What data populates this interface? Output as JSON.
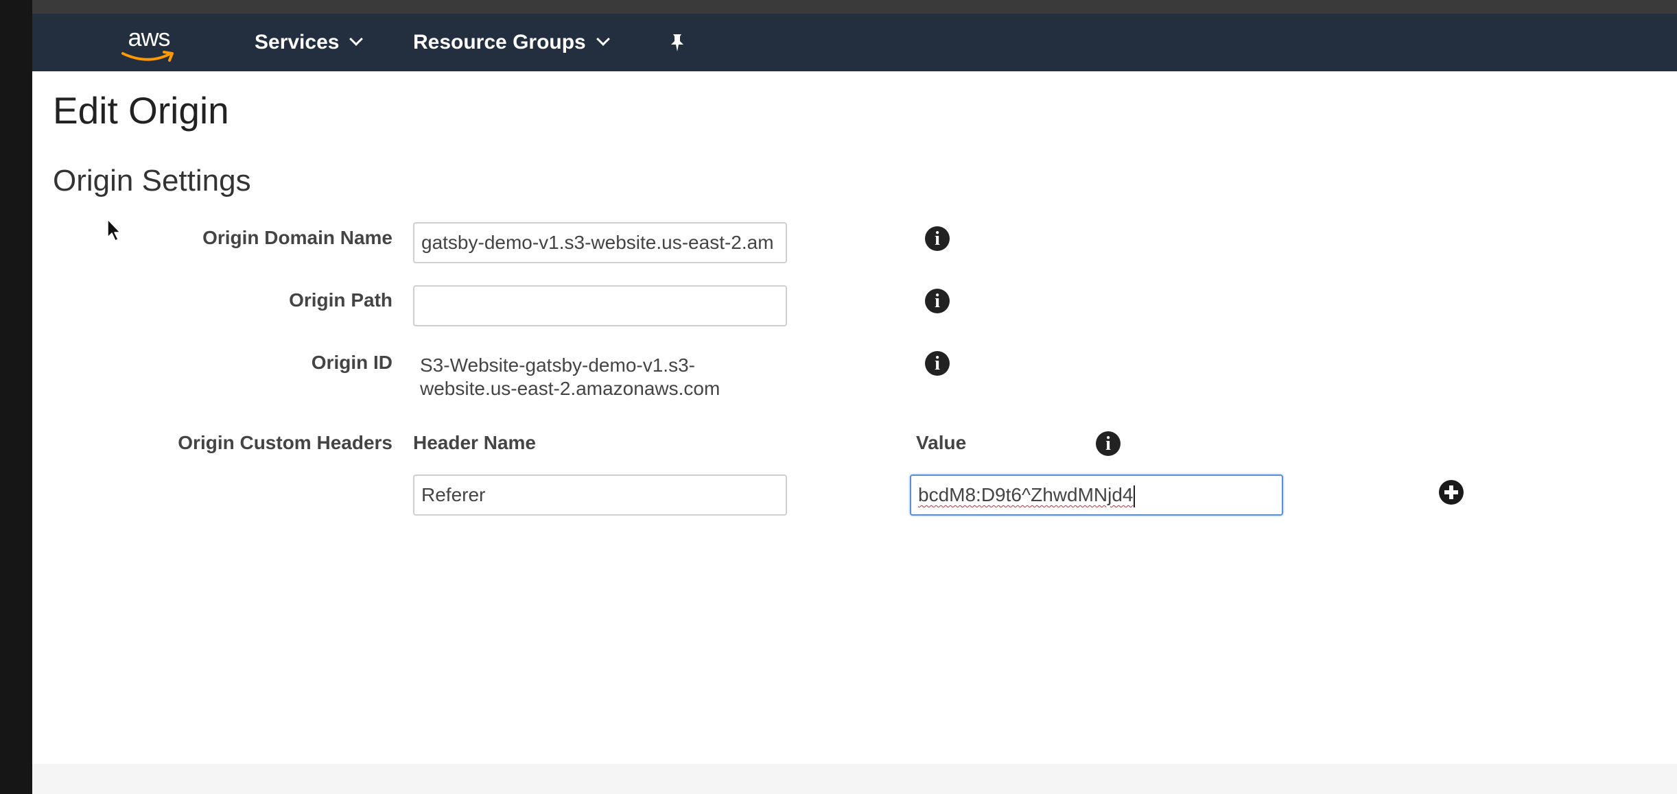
{
  "nav": {
    "logo_text": "aws",
    "services_label": "Services",
    "resource_groups_label": "Resource Groups"
  },
  "page": {
    "title": "Edit Origin",
    "section_title": "Origin Settings"
  },
  "form": {
    "domain_name_label": "Origin Domain Name",
    "domain_name_value": "gatsby-demo-v1.s3-website.us-east-2.am",
    "path_label": "Origin Path",
    "path_value": "",
    "origin_id_label": "Origin ID",
    "origin_id_value": "S3-Website-gatsby-demo-v1.s3-website.us-east-2.amazonaws.com",
    "custom_headers_label": "Origin Custom Headers",
    "header_name_col": "Header Name",
    "value_col": "Value",
    "header_name_value": "Referer",
    "header_value_value": "bcdM8:D9t6^ZhwdMNjd4"
  },
  "icons": {
    "info_glyph": "i"
  },
  "colors": {
    "navbar": "#232f3e",
    "focus_border": "#5b8fd6"
  }
}
